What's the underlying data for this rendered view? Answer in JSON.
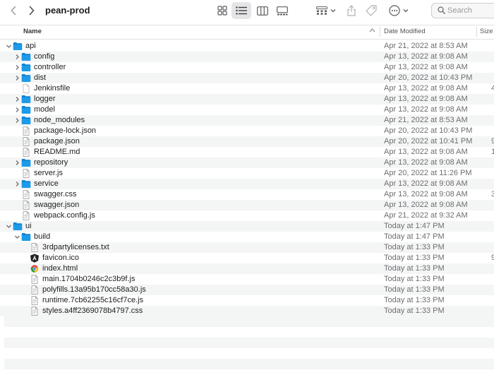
{
  "window": {
    "title": "pean-prod"
  },
  "toolbar": {
    "search_placeholder": "Search",
    "icons": [
      "chevron-left-icon",
      "chevron-right-icon",
      "icon-view-icon",
      "list-view-icon",
      "column-view-icon",
      "gallery-view-icon",
      "group-icon",
      "share-icon",
      "tag-icon",
      "more-icon",
      "magnifier-icon"
    ]
  },
  "columns": {
    "name": "Name",
    "date": "Date Modified",
    "size": "Size"
  },
  "files": [
    {
      "name": "api",
      "date": "Apr 21, 2022 at 8:53 AM",
      "size": "",
      "depth": 0,
      "kind": "folder",
      "expanded": true
    },
    {
      "name": "config",
      "date": "Apr 13, 2022 at 9:08 AM",
      "size": "",
      "depth": 1,
      "kind": "folder",
      "expanded": false
    },
    {
      "name": "controller",
      "date": "Apr 13, 2022 at 9:08 AM",
      "size": "",
      "depth": 1,
      "kind": "folder",
      "expanded": false
    },
    {
      "name": "dist",
      "date": "Apr 20, 2022 at 10:43 PM",
      "size": "",
      "depth": 1,
      "kind": "folder",
      "expanded": false
    },
    {
      "name": "Jenkinsfile",
      "date": "Apr 13, 2022 at 9:08 AM",
      "size": "4",
      "depth": 1,
      "kind": "blank"
    },
    {
      "name": "logger",
      "date": "Apr 13, 2022 at 9:08 AM",
      "size": "",
      "depth": 1,
      "kind": "folder",
      "expanded": false
    },
    {
      "name": "model",
      "date": "Apr 13, 2022 at 9:08 AM",
      "size": "",
      "depth": 1,
      "kind": "folder",
      "expanded": false
    },
    {
      "name": "node_modules",
      "date": "Apr 21, 2022 at 8:53 AM",
      "size": "",
      "depth": 1,
      "kind": "folder",
      "expanded": false
    },
    {
      "name": "package-lock.json",
      "date": "Apr 20, 2022 at 10:43 PM",
      "size": "",
      "depth": 1,
      "kind": "doc"
    },
    {
      "name": "package.json",
      "date": "Apr 20, 2022 at 10:41 PM",
      "size": "9",
      "depth": 1,
      "kind": "doc"
    },
    {
      "name": "README.md",
      "date": "Apr 13, 2022 at 9:08 AM",
      "size": "1",
      "depth": 1,
      "kind": "doc"
    },
    {
      "name": "repository",
      "date": "Apr 13, 2022 at 9:08 AM",
      "size": "",
      "depth": 1,
      "kind": "folder",
      "expanded": false
    },
    {
      "name": "server.js",
      "date": "Apr 20, 2022 at 11:26 PM",
      "size": "",
      "depth": 1,
      "kind": "doc"
    },
    {
      "name": "service",
      "date": "Apr 13, 2022 at 9:08 AM",
      "size": "",
      "depth": 1,
      "kind": "folder",
      "expanded": false
    },
    {
      "name": "swagger.css",
      "date": "Apr 13, 2022 at 9:08 AM",
      "size": "3",
      "depth": 1,
      "kind": "doc"
    },
    {
      "name": "swagger.json",
      "date": "Apr 13, 2022 at 9:08 AM",
      "size": "",
      "depth": 1,
      "kind": "doc"
    },
    {
      "name": "webpack.config.js",
      "date": "Apr 21, 2022 at 9:32 AM",
      "size": "",
      "depth": 1,
      "kind": "doc"
    },
    {
      "name": "ui",
      "date": "Today at 1:47 PM",
      "size": "",
      "depth": 0,
      "kind": "folder",
      "expanded": true
    },
    {
      "name": "build",
      "date": "Today at 1:47 PM",
      "size": "",
      "depth": 1,
      "kind": "folder",
      "expanded": true
    },
    {
      "name": "3rdpartylicenses.txt",
      "date": "Today at 1:33 PM",
      "size": "",
      "depth": 2,
      "kind": "doc"
    },
    {
      "name": "favicon.ico",
      "date": "Today at 1:33 PM",
      "size": "9",
      "depth": 2,
      "kind": "angular"
    },
    {
      "name": "index.html",
      "date": "Today at 1:33 PM",
      "size": "",
      "depth": 2,
      "kind": "chrome"
    },
    {
      "name": "main.1704b0246c2c3b9f.js",
      "date": "Today at 1:33 PM",
      "size": "",
      "depth": 2,
      "kind": "doc"
    },
    {
      "name": "polyfills.13a95b170cc58a30.js",
      "date": "Today at 1:33 PM",
      "size": "",
      "depth": 2,
      "kind": "doc"
    },
    {
      "name": "runtime.7cb62255c16cf7ce.js",
      "date": "Today at 1:33 PM",
      "size": "",
      "depth": 2,
      "kind": "doc"
    },
    {
      "name": "styles.a4ff2369078b4797.css",
      "date": "Today at 1:33 PM",
      "size": "",
      "depth": 2,
      "kind": "doc"
    }
  ],
  "colors": {
    "folder": "#1e9be8",
    "folder_dark": "#0b84d6",
    "selected_view": "#e5e5e7",
    "row_alt": "#f4f5f5"
  }
}
